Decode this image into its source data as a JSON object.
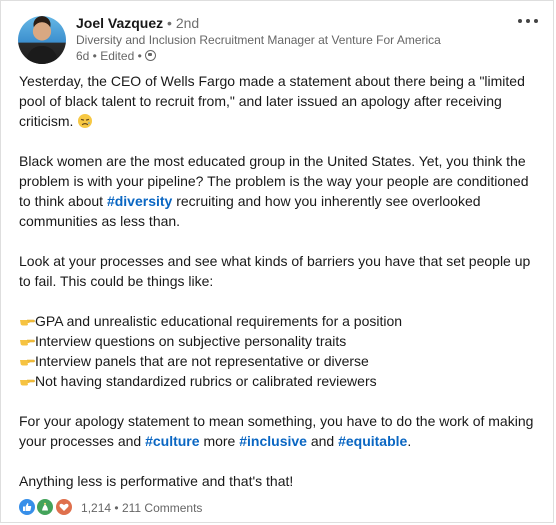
{
  "post": {
    "author": {
      "name": "Joel Vazquez",
      "degree": "• 2nd",
      "headline": "Diversity and Inclusion Recruitment Manager at Venture For America",
      "meta": "6d • Edited •"
    },
    "paragraphs": {
      "p1": "Yesterday, the CEO of Wells Fargo made a statement about there being a \"limited pool of black talent to recruit from,\" and later issued an apology after receiving criticism.",
      "p2_a": "Black women are the most educated group in the United States. Yet, you think the problem is with your pipeline? The problem is the way your people are conditioned to think about",
      "p2_tag": "#diversity",
      "p2_b": "recruiting and how you inherently see overlooked communities as less than.",
      "p3": "Look at your processes and see what kinds of barriers you have that set people up to fail. This could be things like:",
      "list": [
        "GPA and unrealistic educational requirements for a position",
        "Interview questions on subjective personality traits",
        "Interview panels that are not representative or diverse",
        "Not having standardized rubrics or calibrated reviewers"
      ],
      "p5_a": "For your apology statement to mean something, you have to do the work of making your processes and",
      "p5_tag1": "#culture",
      "p5_mid1": "more",
      "p5_tag2": "#inclusive",
      "p5_mid2": "and",
      "p5_tag3": "#equitable",
      "p5_end": ".",
      "p6": "Anything less is performative and that's that!"
    },
    "social": {
      "reactions_count": "1,214",
      "separator": "•",
      "comments": "211 Comments"
    },
    "icons": {
      "more": "more-options-icon",
      "globe": "globe-icon",
      "pointing_hand": "pointing-hand-emoji",
      "sad_face": "sad-face-emoji",
      "like": "like-reaction-icon",
      "celebrate": "celebrate-reaction-icon",
      "love": "love-reaction-icon"
    },
    "colors": {
      "hashtag": "#0a66c2",
      "like": "#378fe9",
      "celebrate": "#44a35a",
      "love": "#df704d"
    }
  }
}
